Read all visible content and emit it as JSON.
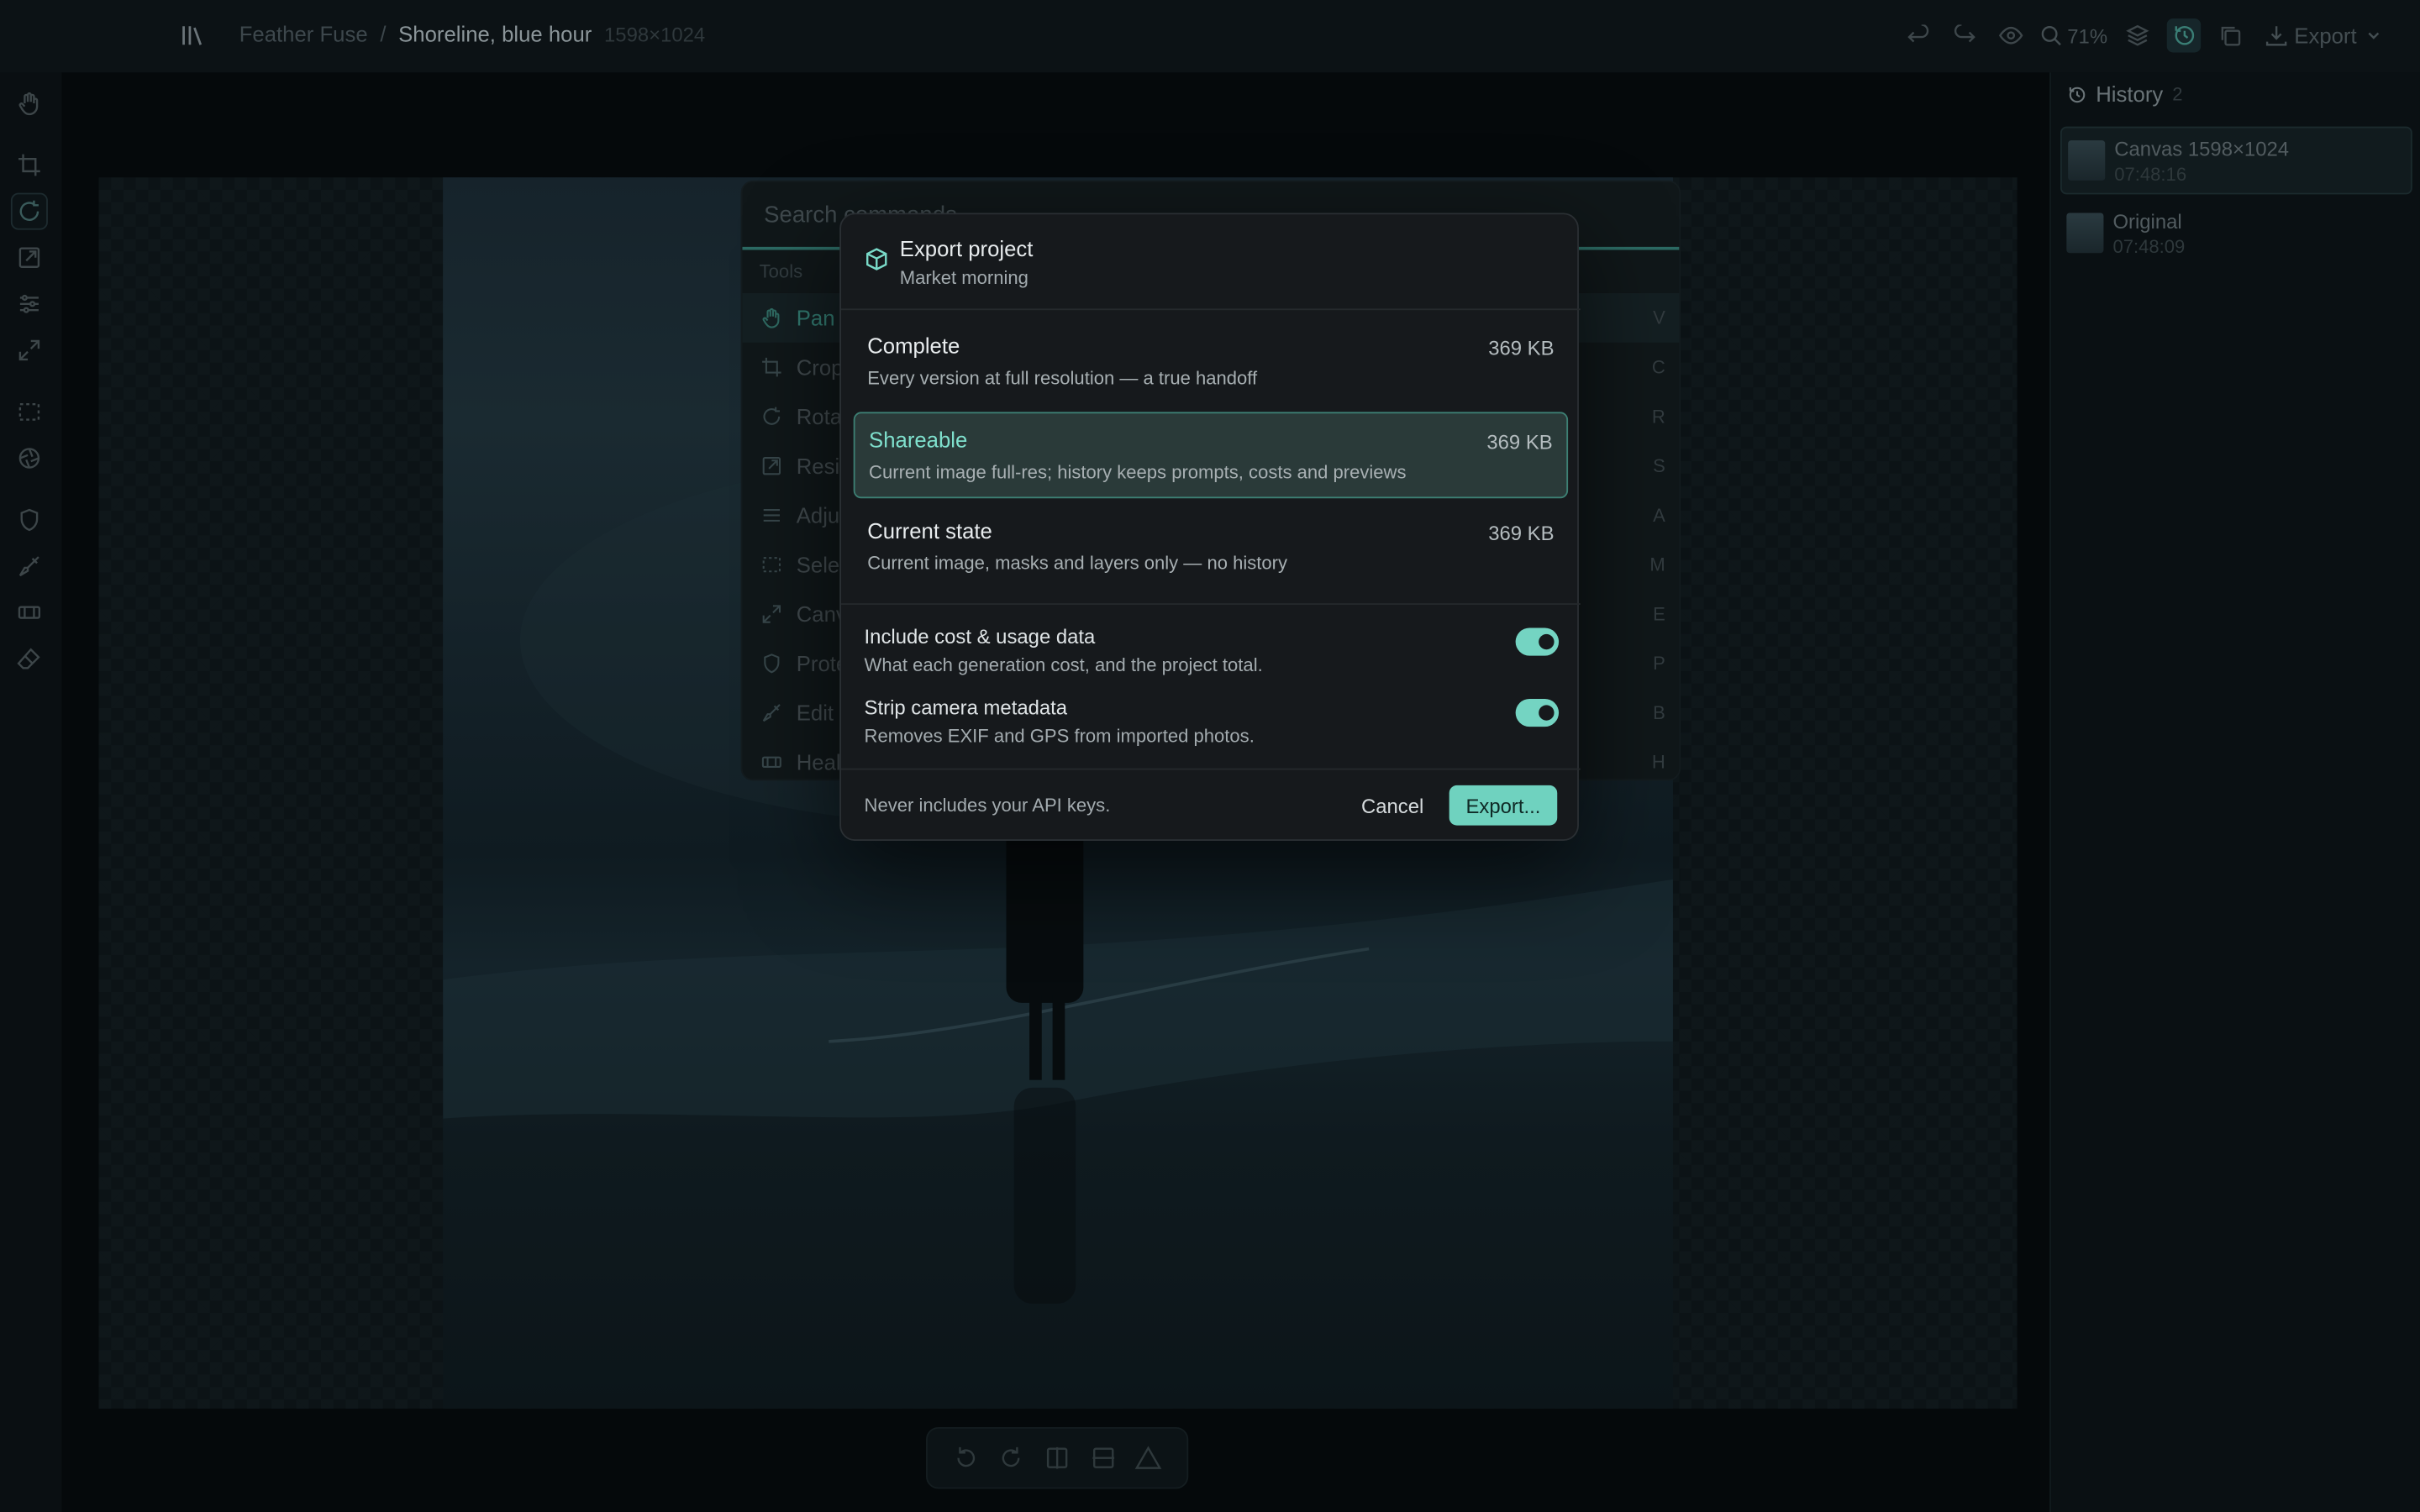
{
  "header": {
    "project": "Feather Fuse",
    "separator": "/",
    "document": "Shoreline, blue hour",
    "dimensions": "1598×1024",
    "zoom": "71%",
    "export_label": "Export"
  },
  "history": {
    "title": "History",
    "count": "2",
    "items": [
      {
        "name": "Canvas 1598×1024",
        "time": "07:48:16"
      },
      {
        "name": "Original",
        "time": "07:48:09"
      }
    ]
  },
  "palette": {
    "placeholder": "Search commands",
    "section": "Tools",
    "items": [
      {
        "label": "Pan",
        "key": "V",
        "icon": "hand-icon"
      },
      {
        "label": "Crop",
        "key": "C",
        "icon": "crop-icon"
      },
      {
        "label": "Rotate",
        "key": "R",
        "icon": "rotate-icon"
      },
      {
        "label": "Resize",
        "key": "S",
        "icon": "resize-icon"
      },
      {
        "label": "Adjust",
        "key": "A",
        "icon": "sliders-icon"
      },
      {
        "label": "Select",
        "key": "M",
        "icon": "marquee-icon"
      },
      {
        "label": "Canvas",
        "key": "E",
        "icon": "expand-icon"
      },
      {
        "label": "Protect",
        "key": "P",
        "icon": "shield-icon"
      },
      {
        "label": "Edit",
        "key": "B",
        "icon": "brush-icon"
      },
      {
        "label": "Heal",
        "key": "H",
        "icon": "bandage-icon"
      }
    ]
  },
  "modal": {
    "title": "Export project",
    "subtitle": "Market morning",
    "options": [
      {
        "name": "Complete",
        "size": "369 KB",
        "desc": "Every version at full resolution — a true handoff"
      },
      {
        "name": "Shareable",
        "size": "369 KB",
        "desc": "Current image full-res; history keeps prompts, costs and previews"
      },
      {
        "name": "Current state",
        "size": "369 KB",
        "desc": "Current image, masks and layers only — no history"
      }
    ],
    "selected_option": "Shareable",
    "toggles": [
      {
        "title": "Include cost & usage data",
        "desc": "What each generation cost, and the project total.",
        "on": true
      },
      {
        "title": "Strip camera metadata",
        "desc": "Removes EXIF and GPS from imported photos.",
        "on": true
      }
    ],
    "footer_note": "Never includes your API keys.",
    "cancel_label": "Cancel",
    "export_label": "Export..."
  },
  "colors": {
    "accent": "#6fd2bf",
    "modal_bg": "#16191c",
    "app_bg": "#0a1013"
  }
}
